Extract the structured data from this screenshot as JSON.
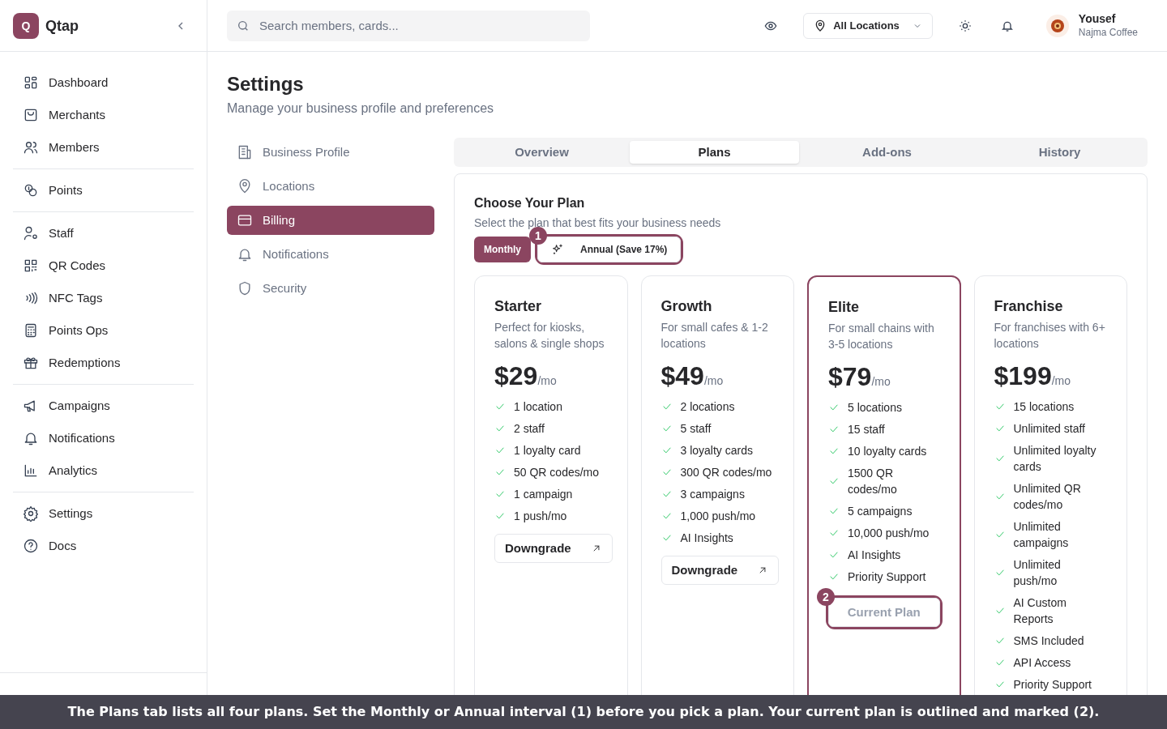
{
  "brand": {
    "logo_letter": "Q",
    "name": "Qtap"
  },
  "sidebar": {
    "groups": [
      {
        "items": [
          "Dashboard",
          "Merchants",
          "Members"
        ]
      },
      {
        "items": [
          "Points"
        ]
      },
      {
        "items": [
          "Staff",
          "QR Codes",
          "NFC Tags",
          "Points Ops",
          "Redemptions"
        ]
      },
      {
        "items": [
          "Campaigns",
          "Notifications",
          "Analytics"
        ]
      },
      {
        "items": [
          "Settings",
          "Docs"
        ]
      }
    ]
  },
  "header": {
    "search": {
      "placeholder": "Search members, cards..."
    },
    "location": "All Locations",
    "user": {
      "name": "Yousef",
      "business": "Najma Coffee"
    }
  },
  "page": {
    "title": "Settings",
    "subtitle": "Manage your business profile and preferences"
  },
  "settings_nav": [
    {
      "label": "Business Profile",
      "selected": false
    },
    {
      "label": "Locations",
      "selected": false
    },
    {
      "label": "Billing",
      "selected": true
    },
    {
      "label": "Notifications",
      "selected": false
    },
    {
      "label": "Security",
      "selected": false
    }
  ],
  "tabs": [
    {
      "label": "Overview",
      "selected": false
    },
    {
      "label": "Plans",
      "selected": true
    },
    {
      "label": "Add-ons",
      "selected": false
    },
    {
      "label": "History",
      "selected": false
    }
  ],
  "plan_section": {
    "title": "Choose Your Plan",
    "subtitle": "Select the plan that best fits your business needs",
    "intervals": [
      {
        "label": "Monthly",
        "selected": true
      },
      {
        "label": "Annual (Save 17%)",
        "selected": false,
        "marker": "1"
      }
    ],
    "plans": [
      {
        "name": "Starter",
        "description": "Perfect for kiosks, salons & single shops",
        "price": "$29",
        "period": "/mo",
        "current": false,
        "features": [
          "1 location",
          "2 staff",
          "1 loyalty card",
          "50 QR codes/mo",
          "1 campaign",
          "1 push/mo"
        ],
        "button": {
          "label": "Downgrade",
          "kind": "downgrade"
        }
      },
      {
        "name": "Growth",
        "description": "For small cafes & 1-2 locations",
        "price": "$49",
        "period": "/mo",
        "current": false,
        "features": [
          "2 locations",
          "5 staff",
          "3 loyalty cards",
          "300 QR codes/mo",
          "3 campaigns",
          "1,000 push/mo",
          "AI Insights"
        ],
        "button": {
          "label": "Downgrade",
          "kind": "downgrade"
        }
      },
      {
        "name": "Elite",
        "description": "For small chains with 3-5 locations",
        "price": "$79",
        "period": "/mo",
        "current": true,
        "features": [
          "5 locations",
          "15 staff",
          "10 loyalty cards",
          "1500 QR codes/mo",
          "5 campaigns",
          "10,000 push/mo",
          "AI Insights",
          "Priority Support"
        ],
        "button": {
          "label": "Current Plan",
          "kind": "current",
          "marker": "2"
        }
      },
      {
        "name": "Franchise",
        "description": "For franchises with 6+ locations",
        "price": "$199",
        "period": "/mo",
        "current": false,
        "features": [
          "15 locations",
          "Unlimited staff",
          "Unlimited loyalty cards",
          "Unlimited QR codes/mo",
          "Unlimited campaigns",
          "Unlimited push/mo",
          "AI Custom Reports",
          "SMS Included",
          "API Access",
          "Priority Support"
        ]
      }
    ]
  },
  "caption": "The Plans tab lists all four plans. Set the Monthly or Annual interval (1) before you pick a plan. Your current plan is outlined and marked (2)."
}
